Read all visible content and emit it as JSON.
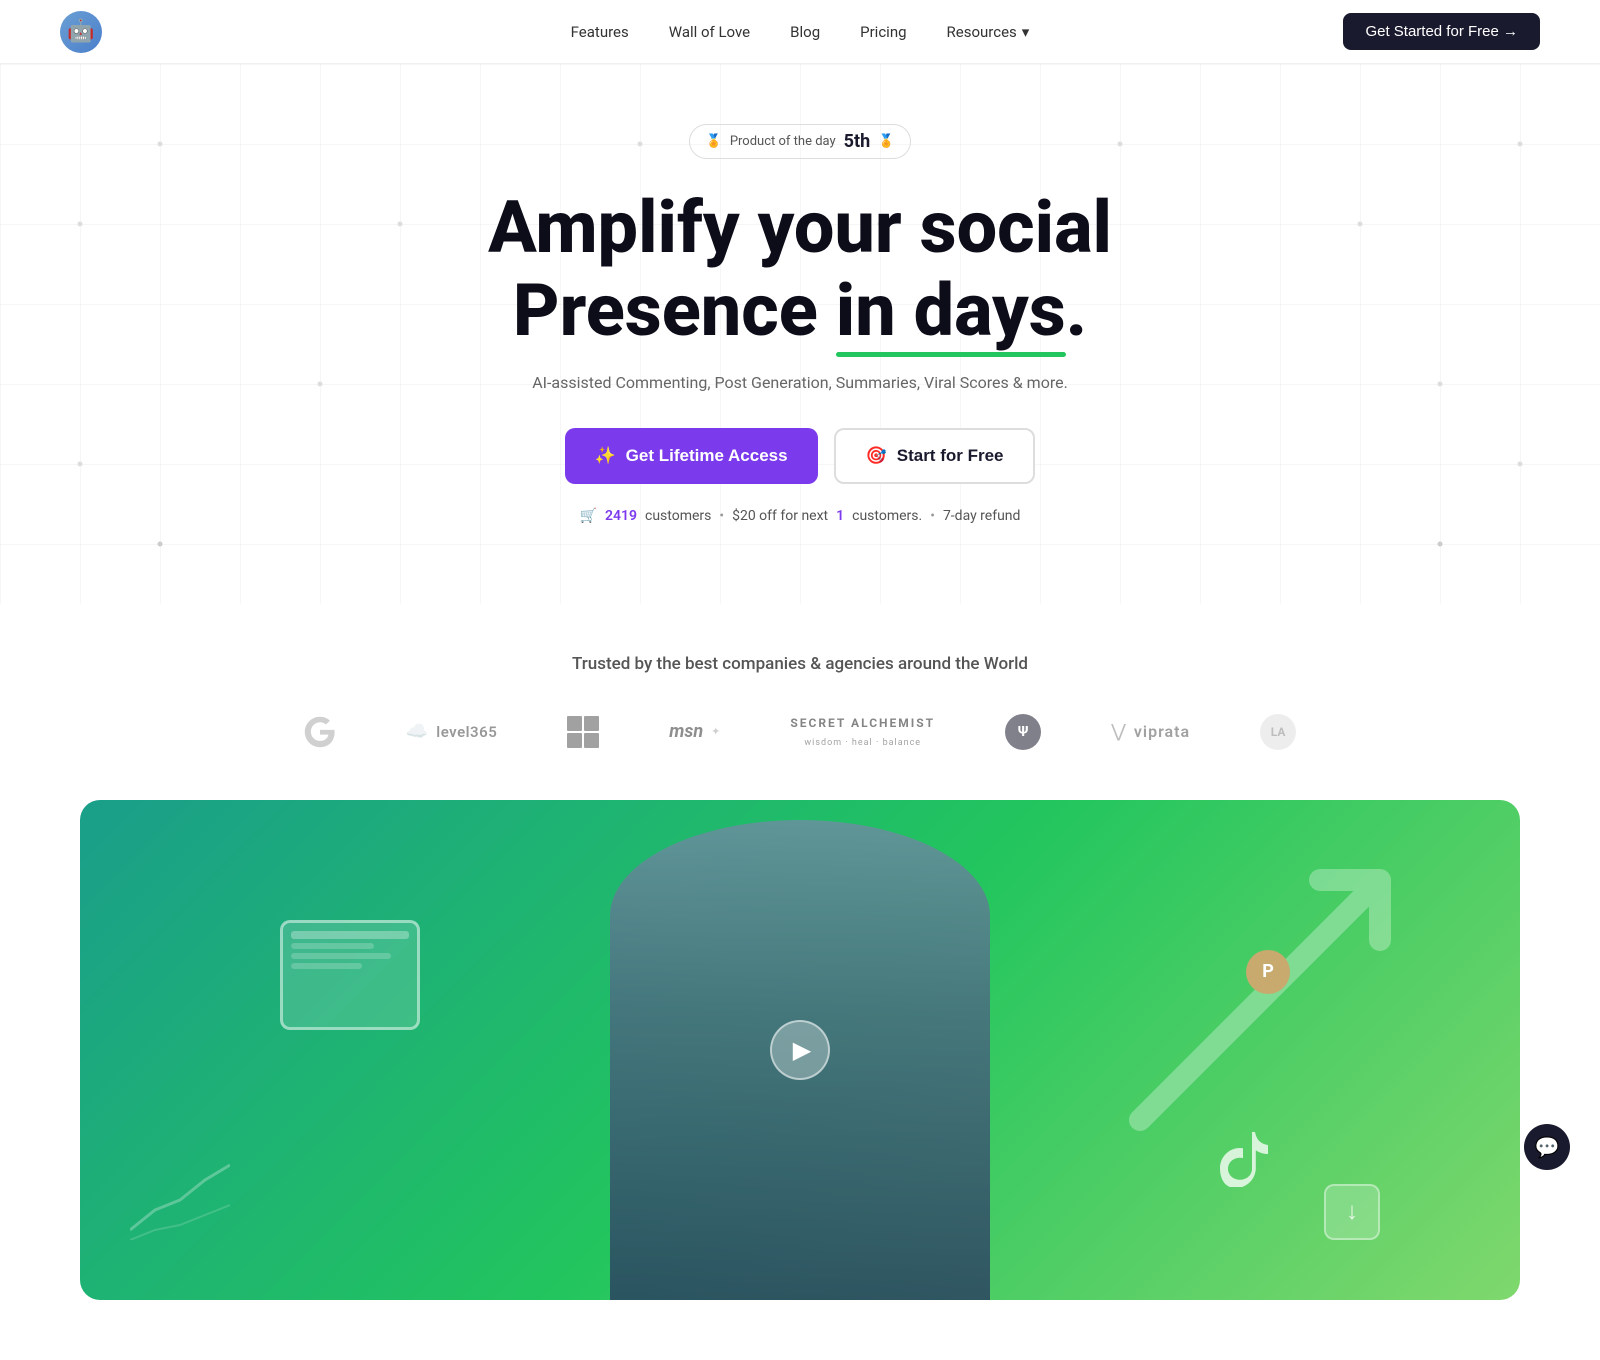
{
  "nav": {
    "logo_emoji": "🤖",
    "links": [
      {
        "label": "Features",
        "id": "features"
      },
      {
        "label": "Wall of Love",
        "id": "wall-of-love"
      },
      {
        "label": "Blog",
        "id": "blog"
      },
      {
        "label": "Pricing",
        "id": "pricing"
      },
      {
        "label": "Resources",
        "id": "resources",
        "has_dropdown": true
      }
    ],
    "cta_label": "Get Started for Free →"
  },
  "badge": {
    "prefix": "Product of the day",
    "number": "5th"
  },
  "hero": {
    "title_line1": "Amplify your social",
    "title_line2_prefix": "Presence ",
    "title_line2_underline": "in days",
    "title_line2_suffix": ".",
    "subtitle": "AI-assisted Commenting, Post Generation, Summaries, Viral Scores & more.",
    "btn_primary": "Get Lifetime Access",
    "btn_primary_icon": "✨",
    "btn_secondary": "Start for Free",
    "btn_secondary_icon": "🎯"
  },
  "social_proof": {
    "icon": "🛒",
    "customers_count": "2419",
    "customers_label": "customers",
    "offer_text": "$20 off for next",
    "offer_count": "1",
    "offer_suffix": "customers.",
    "refund": "7-day refund"
  },
  "trusted": {
    "title": "Trusted by the best companies & agencies around the World",
    "logos": [
      {
        "id": "google",
        "type": "google",
        "text": "G"
      },
      {
        "id": "level365",
        "type": "level365",
        "text": "level365"
      },
      {
        "id": "windows",
        "type": "windows",
        "text": ""
      },
      {
        "id": "msn",
        "type": "msn",
        "text": "msn"
      },
      {
        "id": "secret-alchemist",
        "type": "text",
        "text": "SECRET ALCHEMIST",
        "subtext": "wisdom · heal · balance"
      },
      {
        "id": "wm",
        "type": "circle",
        "text": "Ψ"
      },
      {
        "id": "viprata",
        "type": "viprata",
        "text": "viprata"
      },
      {
        "id": "la",
        "type": "circle-gray",
        "text": "LA"
      }
    ]
  },
  "video": {
    "play_label": "▶"
  },
  "chat": {
    "icon": "💬"
  }
}
